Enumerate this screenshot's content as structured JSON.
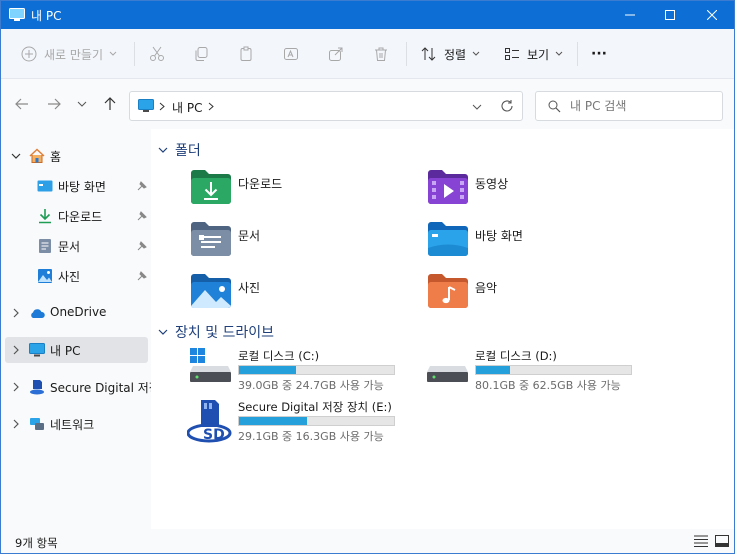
{
  "window": {
    "title": "내 PC"
  },
  "toolbar": {
    "new_label": "새로 만들기",
    "sort_label": "정렬",
    "view_label": "보기",
    "more_label": "···"
  },
  "address": {
    "location": "내 PC",
    "search_placeholder": "내 PC 검색"
  },
  "sidebar": {
    "items": [
      {
        "label": "홈",
        "icon": "home-icon"
      },
      {
        "label": "바탕 화면",
        "icon": "desktop-icon"
      },
      {
        "label": "다운로드",
        "icon": "download-icon"
      },
      {
        "label": "문서",
        "icon": "document-icon"
      },
      {
        "label": "사진",
        "icon": "picture-icon"
      },
      {
        "label": "OneDrive",
        "icon": "cloud-icon"
      },
      {
        "label": "내 PC",
        "icon": "computer-icon"
      },
      {
        "label": "Secure Digital 저장",
        "icon": "sd-card-icon"
      },
      {
        "label": "네트워크",
        "icon": "network-icon"
      }
    ]
  },
  "folders": {
    "header": "폴더",
    "items": [
      {
        "label": "다운로드",
        "icon": "downloads-folder-icon"
      },
      {
        "label": "동영상",
        "icon": "videos-folder-icon"
      },
      {
        "label": "문서",
        "icon": "documents-folder-icon"
      },
      {
        "label": "바탕 화면",
        "icon": "desktop-folder-icon"
      },
      {
        "label": "사진",
        "icon": "pictures-folder-icon"
      },
      {
        "label": "음악",
        "icon": "music-folder-icon"
      }
    ]
  },
  "drives": {
    "header": "장치 및 드라이브",
    "items": [
      {
        "name": "로컬 디스크 (C:)",
        "info": "39.0GB 중 24.7GB 사용 가능",
        "used_fraction": 0.37,
        "icon": "windows-drive-icon"
      },
      {
        "name": "로컬 디스크 (D:)",
        "info": "80.1GB 중 62.5GB 사용 가능",
        "used_fraction": 0.22,
        "icon": "hard-drive-icon"
      },
      {
        "name": "Secure Digital 저장 장치 (E:)",
        "info": "29.1GB 중 16.3GB 사용 가능",
        "used_fraction": 0.44,
        "icon": "sd-drive-icon"
      }
    ]
  },
  "status": {
    "item_count": "9개 항목"
  },
  "colors": {
    "titlebar": "#0d6fd6",
    "accent": "#26a0da",
    "section_header": "#1e3f7a"
  }
}
